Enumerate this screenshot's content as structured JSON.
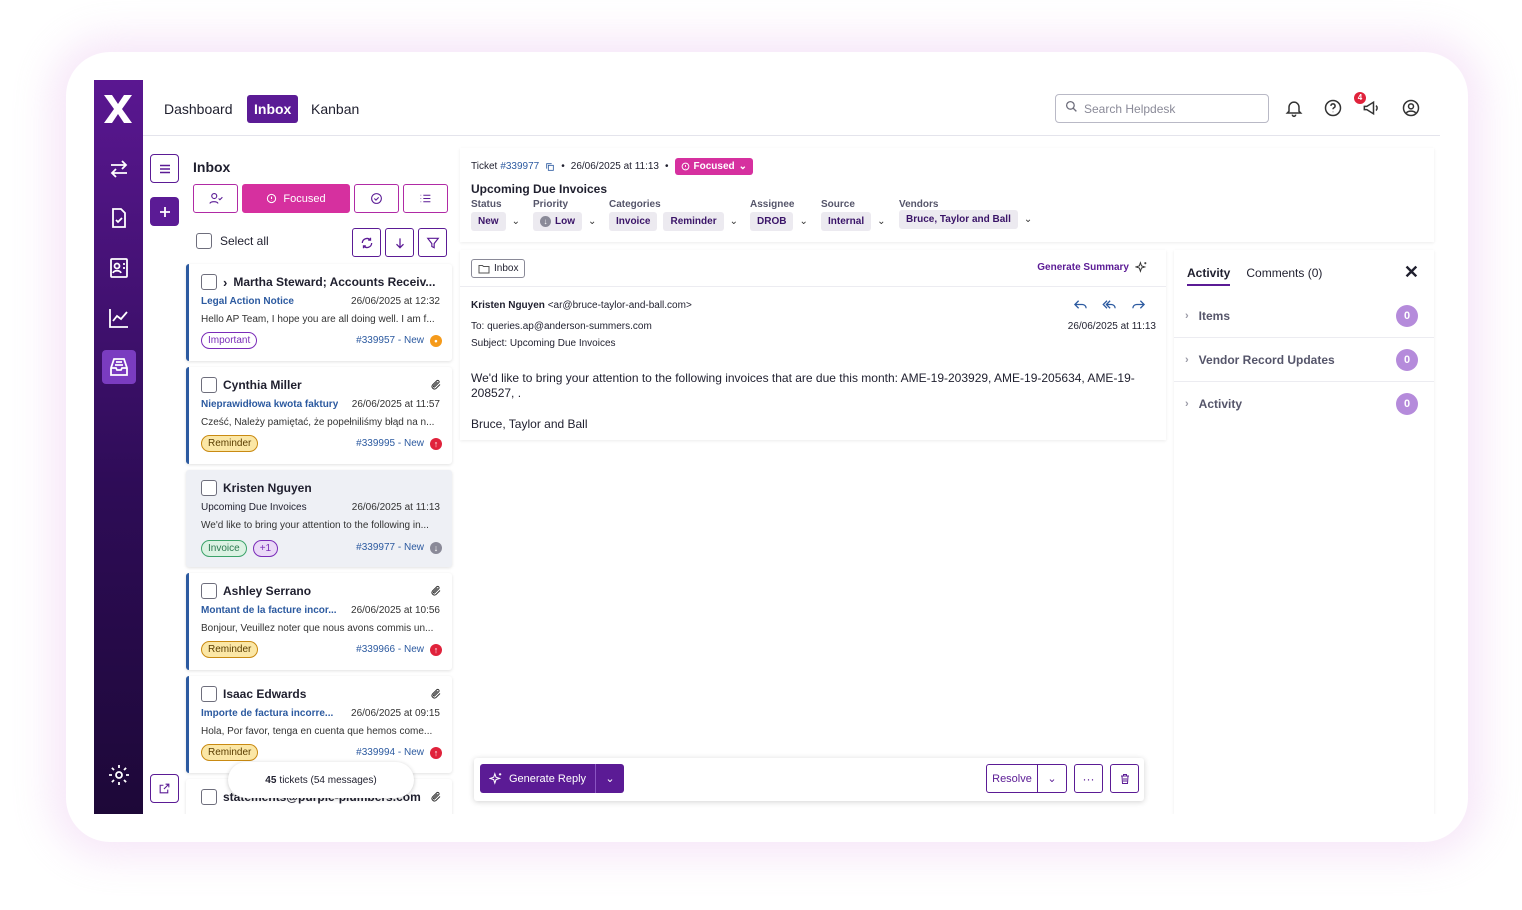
{
  "nav": {
    "links": [
      "Dashboard",
      "Inbox",
      "Kanban"
    ],
    "search_placeholder": "Search Helpdesk",
    "notification_badge": "4"
  },
  "inbox": {
    "title": "Inbox",
    "focused_label": "Focused",
    "select_all": "Select all",
    "cards": [
      {
        "name": "Martha Steward; Accounts Receiv...",
        "category": "Legal Action Notice",
        "date": "26/06/2025 at 12:32",
        "preview": "Hello AP Team, I hope you are all doing well. I am f...",
        "tag": "Important",
        "ref": "#339957 - New"
      },
      {
        "name": "Cynthia Miller",
        "category": "Nieprawidłowa kwota faktury",
        "date": "26/06/2025 at 11:57",
        "preview": "Cześć, Należy pamiętać, że popełniliśmy błąd na n...",
        "tag": "Reminder",
        "ref": "#339995 - New"
      },
      {
        "name": "Kristen Nguyen",
        "category": "Upcoming Due Invoices",
        "date": "26/06/2025 at 11:13",
        "preview": "We'd like to bring your attention to the following in...",
        "tag": "Invoice",
        "tag_extra": "+1",
        "ref": "#339977 - New"
      },
      {
        "name": "Ashley Serrano",
        "category": "Montant de la facture incor...",
        "date": "26/06/2025 at 10:56",
        "preview": "Bonjour, Veuillez noter que nous avons commis un...",
        "tag": "Reminder",
        "ref": "#339966 - New"
      },
      {
        "name": "Isaac Edwards",
        "category": "Importe de factura incorre...",
        "date": "26/06/2025 at 09:15",
        "preview": "Hola, Por favor, tenga en cuenta que hemos come...",
        "tag": "Reminder",
        "ref": "#339994 - New"
      },
      {
        "name": "statements@purple-plumbers.com"
      }
    ],
    "toast_count": "45",
    "toast_text": "tickets (54 messages)"
  },
  "ticket": {
    "label": "Ticket",
    "number": "#339977",
    "date": "26/06/2025 at 11:13",
    "focus": "Focused",
    "title": "Upcoming Due Invoices",
    "fields": {
      "status_label": "Status",
      "status": "New",
      "priority_label": "Priority",
      "priority": "Low",
      "categories_label": "Categories",
      "cat1": "Invoice",
      "cat2": "Reminder",
      "assignee_label": "Assignee",
      "assignee": "DROB",
      "source_label": "Source",
      "source": "Internal",
      "vendors_label": "Vendors",
      "vendor": "Bruce, Taylor and Ball"
    }
  },
  "email": {
    "folder": "Inbox",
    "generate_summary": "Generate Summary",
    "from_name": "Kristen Nguyen",
    "from_addr": "<ar@bruce-taylor-and-ball.com>",
    "to_label": "To:",
    "to": "queries.ap@anderson-summers.com",
    "date": "26/06/2025 at 11:13",
    "subject_label": "Subject:",
    "subject": "Upcoming Due Invoices",
    "body": "We'd like to bring your attention to the following invoices that are due this month: AME-19-203929, AME-19-205634, AME-19-208527, .",
    "signature": "Bruce, Taylor and Ball"
  },
  "reply_bar": {
    "generate_reply": "Generate Reply",
    "resolve": "Resolve",
    "more": "···"
  },
  "activity": {
    "tab1": "Activity",
    "tab2": "Comments (0)",
    "rows": [
      {
        "label": "Items",
        "count": "0"
      },
      {
        "label": "Vendor Record Updates",
        "count": "0"
      },
      {
        "label": "Activity",
        "count": "0"
      }
    ]
  }
}
